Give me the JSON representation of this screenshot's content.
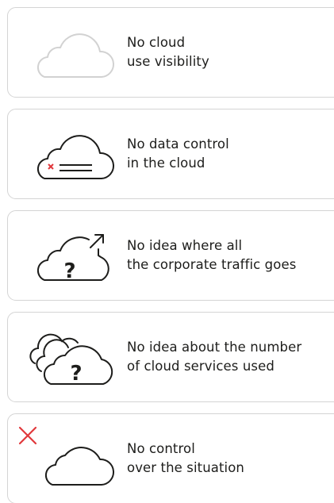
{
  "colors": {
    "card_border": "#d4d4d4",
    "icon_stroke": "#1d1d1b",
    "icon_stroke_muted": "#d2d2d2",
    "alert_red": "#e1383c"
  },
  "items": [
    {
      "icon": "cloud-outline-muted-icon",
      "line1": "No cloud",
      "line2": "use visibility"
    },
    {
      "icon": "cloud-data-cross-icon",
      "line1": "No data control",
      "line2": "in the cloud"
    },
    {
      "icon": "cloud-question-traffic-icon",
      "question_mark": "?",
      "line1": "No idea where all",
      "line2": "the corporate traffic goes"
    },
    {
      "icon": "multi-cloud-question-icon",
      "question_mark": "?",
      "line1": "No idea about the number",
      "line2": "of cloud services used"
    },
    {
      "icon": "cloud-red-cross-icon",
      "line1": "No control",
      "line2": "over the situation"
    }
  ]
}
